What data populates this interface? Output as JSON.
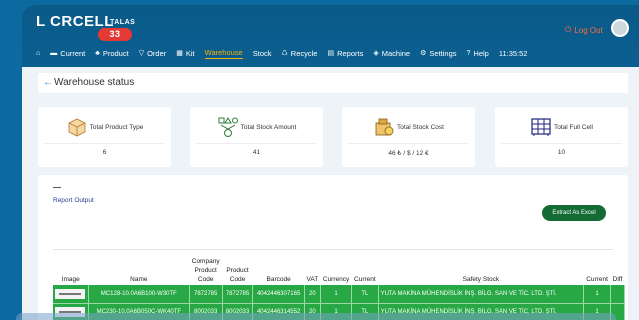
{
  "header": {
    "logo_text": "L CRCELL",
    "logo_sub": "TALAS",
    "logo_badge": "33",
    "logout_label": "Log Out",
    "clock": "11:35:52"
  },
  "nav": {
    "items": [
      {
        "label": "",
        "icon": "home-icon"
      },
      {
        "label": "Current",
        "icon": "current-icon"
      },
      {
        "label": "Product",
        "icon": "product-icon"
      },
      {
        "label": "Order",
        "icon": "order-icon"
      },
      {
        "label": "Kit",
        "icon": "kit-icon"
      },
      {
        "label": "Warehouse",
        "icon": "",
        "active": true
      },
      {
        "label": "Stock",
        "icon": ""
      },
      {
        "label": "Recycle",
        "icon": "recycle-icon"
      },
      {
        "label": "Reports",
        "icon": "reports-icon"
      },
      {
        "label": "Machine",
        "icon": "machine-icon"
      },
      {
        "label": "Settings",
        "icon": "settings-icon"
      },
      {
        "label": "Help",
        "icon": "help-icon"
      }
    ]
  },
  "page": {
    "title": "Warehouse status"
  },
  "cards": [
    {
      "label": "Total Product Type",
      "value": "6",
      "icon": "box-icon"
    },
    {
      "label": "Total Stock Amount",
      "value": "41",
      "icon": "stock-amount-icon"
    },
    {
      "label": "Total Stock Cost",
      "value": "46 ₺ / $ / 12 €",
      "icon": "stock-cost-icon"
    },
    {
      "label": "Total Full Cell",
      "value": "10",
      "icon": "full-cell-icon"
    }
  ],
  "report": {
    "label": "Report Output",
    "excel_button": "Extract As Excel",
    "columns": [
      "Image",
      "Name",
      "Company Product Code",
      "Product Code",
      "Barcode",
      "VAT",
      "Currency",
      "Current",
      "Safety Stock",
      "Current",
      "Diff"
    ],
    "rows": [
      [
        "",
        "MC128-10.0A6B100-W30TF",
        "7872785",
        "7872785",
        "4042446307165",
        "20",
        "1",
        "TL",
        "YUTA MAKİNA MÜHENDİSLİK İNŞ. BİLG. SAN VE TİC. LTD. ŞTİ.",
        "1",
        ""
      ],
      [
        "",
        "MC230-10.0A6B050C-WK40TF",
        "8002033",
        "8002033",
        "4042446314552",
        "20",
        "1",
        "TL",
        "YUTA MAKİNA MÜHENDİSLİK İNŞ. BİLG. SAN VE TİC. LTD. ŞTİ.",
        "1",
        ""
      ]
    ]
  },
  "colors": {
    "header_bg": "#0b5f90",
    "active_nav": "#f4b400",
    "logout": "#ff6b3d",
    "row_green": "#27a844",
    "excel_button": "#146b33"
  }
}
